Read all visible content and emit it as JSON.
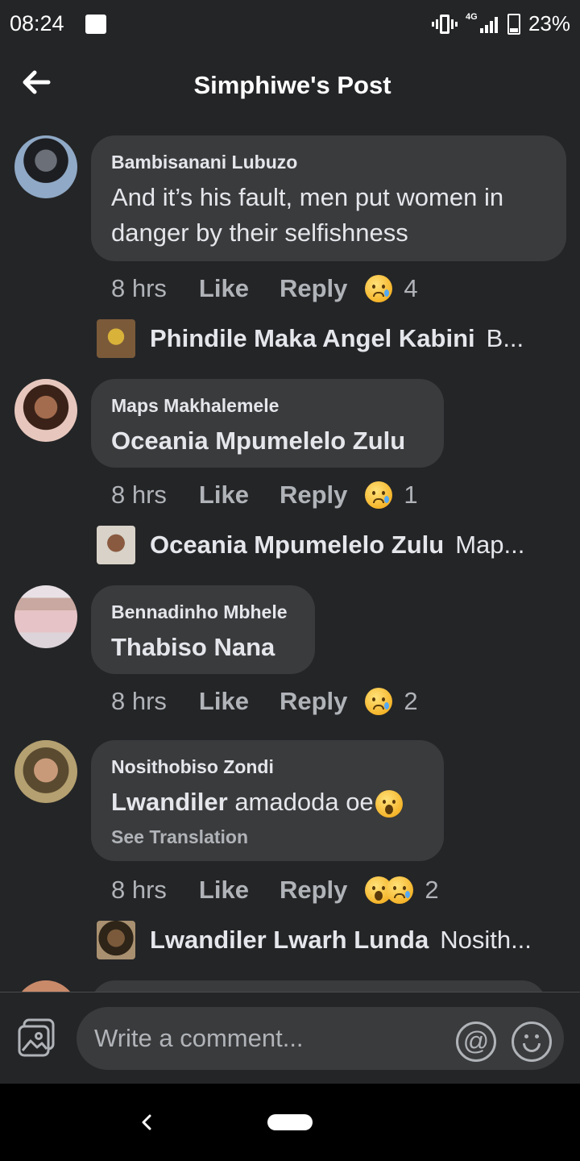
{
  "status_bar": {
    "time": "08:24",
    "network": "4G",
    "battery": "23%"
  },
  "header": {
    "title": "Simphiwe's Post"
  },
  "comments": [
    {
      "author": "Bambisanani Lubuzo",
      "text_plain": "And it’s his fault, men put women in danger by their selfishness",
      "time": "8 hrs",
      "like": "Like",
      "reply": "Reply",
      "reaction_count": "4",
      "reply_preview": {
        "author": "Phindile Maka Angel Kabini",
        "snippet": "B..."
      }
    },
    {
      "author": "Maps Makhalemele",
      "text_bold": "Oceania Mpumelelo Zulu",
      "time": "8 hrs",
      "like": "Like",
      "reply": "Reply",
      "reaction_count": "1",
      "reply_preview": {
        "author": "Oceania Mpumelelo Zulu",
        "snippet": "Map..."
      }
    },
    {
      "author": "Bennadinho Mbhele",
      "text_bold": "Thabiso Nana",
      "time": "8 hrs",
      "like": "Like",
      "reply": "Reply",
      "reaction_count": "2"
    },
    {
      "author": "Nosithobiso Zondi",
      "text_bold": "Lwandiler",
      "text_plain": " amadoda oe",
      "see_translation": "See Translation",
      "time": "8 hrs",
      "like": "Like",
      "reply": "Reply",
      "reaction_count": "2",
      "reply_preview": {
        "author": "Lwandiler Lwarh Lunda",
        "snippet": "Nosith..."
      }
    }
  ],
  "composer": {
    "placeholder": "Write a comment...",
    "mention": "@"
  },
  "colors": {
    "background": "#242527",
    "bubble": "#3a3b3c",
    "secondary_text": "#b0b3b8"
  }
}
